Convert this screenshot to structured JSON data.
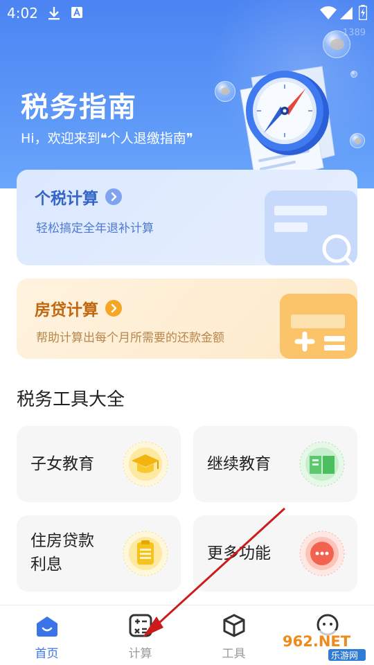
{
  "status_bar": {
    "time": "4:02"
  },
  "watermark_top": "1389",
  "hero": {
    "title": "税务指南",
    "subtitle": "Hi，欢迎来到❝个人退缴指南❞"
  },
  "cards": {
    "tax": {
      "title": "个税计算",
      "subtitle": "轻松搞定全年退补计算"
    },
    "mortgage": {
      "title": "房贷计算",
      "subtitle": "帮助计算出每个月所需要的还款金额"
    }
  },
  "section": {
    "title": "税务工具大全"
  },
  "tools": [
    {
      "label": "子女教育",
      "icon": "graduation-cap-icon"
    },
    {
      "label": "继续教育",
      "icon": "book-icon"
    },
    {
      "label": "住房贷款\n利息",
      "line1": "住房贷款",
      "line2": "利息",
      "icon": "clipboard-icon"
    },
    {
      "label": "更多功能",
      "icon": "more-dots-icon"
    }
  ],
  "tabbar": {
    "items": [
      {
        "label": "首页",
        "icon": "home-icon",
        "active": true
      },
      {
        "label": "计算",
        "icon": "calculator-icon",
        "active": false
      },
      {
        "label": "工具",
        "icon": "cube-icon",
        "active": false
      },
      {
        "label": "",
        "icon": "chat-face-icon",
        "active": false
      }
    ]
  },
  "watermark": {
    "line1": "962.NET",
    "line2": "乐游网"
  },
  "colors": {
    "accent": "#3b73e8",
    "hero": "#5b96f7",
    "tax_card": "#dbe8fe",
    "mortgage_card": "#fdebcb",
    "annotation_arrow": "#cc1b1b"
  }
}
